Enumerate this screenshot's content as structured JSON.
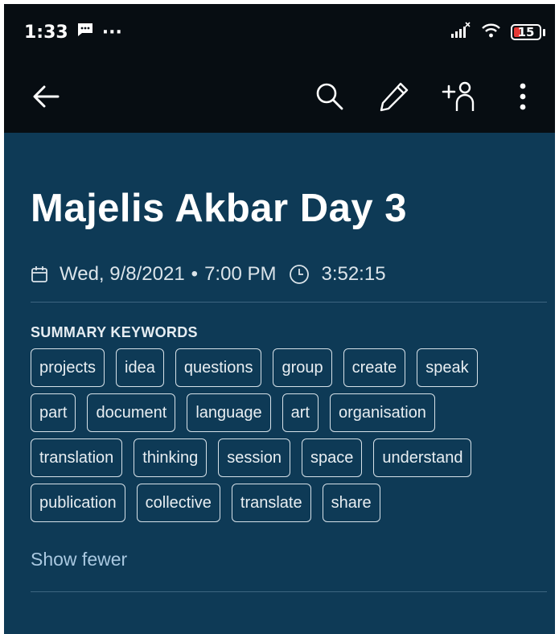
{
  "status_bar": {
    "time": "1:33",
    "dots": "···",
    "battery": "15",
    "battery_color": "#e53935"
  },
  "app_bar": {
    "icons": [
      "back-arrow-icon",
      "search-icon",
      "pencil-icon",
      "add-person-icon",
      "more-vertical-icon"
    ]
  },
  "note": {
    "title": "Majelis Akbar Day 3",
    "date": "Wed, 9/8/2021",
    "separator": "•",
    "time": "7:00 PM",
    "duration": "3:52:15"
  },
  "summary": {
    "header": "SUMMARY KEYWORDS",
    "keywords": [
      "projects",
      "idea",
      "questions",
      "group",
      "create",
      "speak",
      "part",
      "document",
      "language",
      "art",
      "organisation",
      "translation",
      "thinking",
      "session",
      "space",
      "understand",
      "publication",
      "collective",
      "translate",
      "share"
    ],
    "toggle_label": "Show fewer"
  },
  "colors": {
    "background": "#0e3a56",
    "bar": "#070d12",
    "link": "#a9c8e0"
  }
}
